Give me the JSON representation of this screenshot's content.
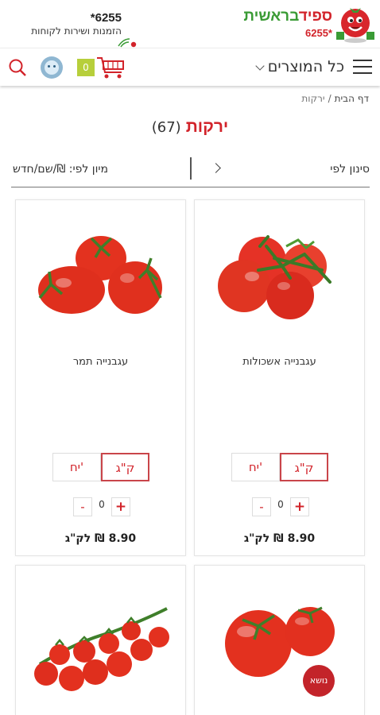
{
  "header": {
    "phone": "6255*",
    "phone_sub": "הזמנות ושירות לקוחות",
    "logo_line1_a": "ספיד",
    "logo_line1_b": "בראשית",
    "logo_number": "6255*"
  },
  "nav": {
    "all_products": "כל המוצרים",
    "cart_count": "0"
  },
  "breadcrumb": {
    "home": "דף הבית",
    "separator": "/",
    "current": "ירקות"
  },
  "page": {
    "title": "ירקות",
    "count": "(67)"
  },
  "filter": {
    "filter_label": "סינון לפי",
    "sort_label": "מיון לפי: ₪/שם/חדש"
  },
  "products": [
    {
      "name": "עגבנייה אשכולות",
      "unit_kg": "ק\"ג",
      "unit_each": "יח'",
      "qty": "0",
      "price": "8.90 ₪ לק\"ג"
    },
    {
      "name": "עגבנייה תמר",
      "unit_kg": "ק\"ג",
      "unit_each": "יח'",
      "qty": "0",
      "price": "8.90 ₪ לק\"ג"
    }
  ],
  "qty_controls": {
    "plus": "+",
    "minus": "-"
  },
  "badge_text": "נושא",
  "colors": {
    "brand_red": "#d2232a",
    "brand_green": "#3a9b35",
    "cart_badge": "#b7cf3b"
  }
}
